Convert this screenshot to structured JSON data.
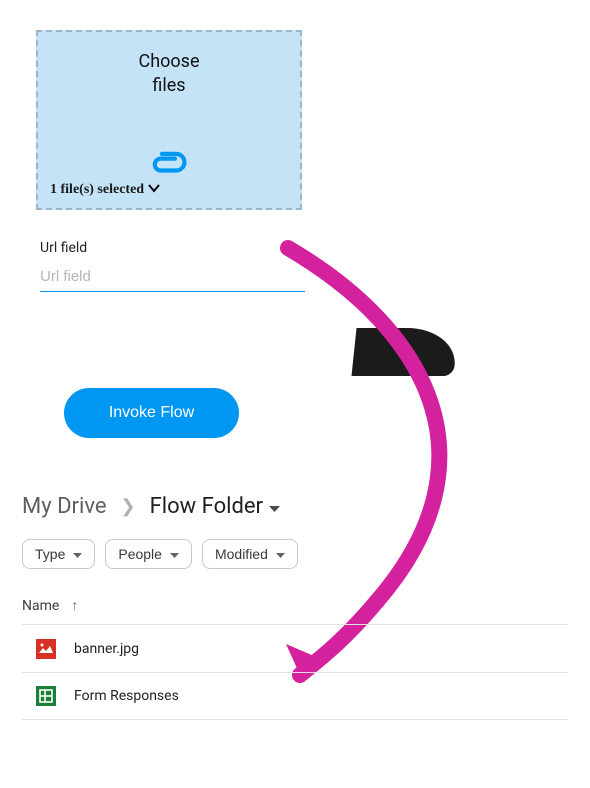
{
  "dropzone": {
    "label_line1": "Choose",
    "label_line2": "files",
    "selected_text": "1 file(s) selected"
  },
  "url": {
    "label": "Url field",
    "placeholder": "Url field",
    "value": ""
  },
  "invoke_label": "Invoke Flow",
  "drive": {
    "root": "My Drive",
    "current": "Flow Folder",
    "filters": {
      "type": "Type",
      "people": "People",
      "modified": "Modified"
    },
    "col_name": "Name",
    "files": [
      {
        "name": "banner.jpg",
        "kind": "image"
      },
      {
        "name": "Form Responses",
        "kind": "sheet"
      }
    ]
  }
}
